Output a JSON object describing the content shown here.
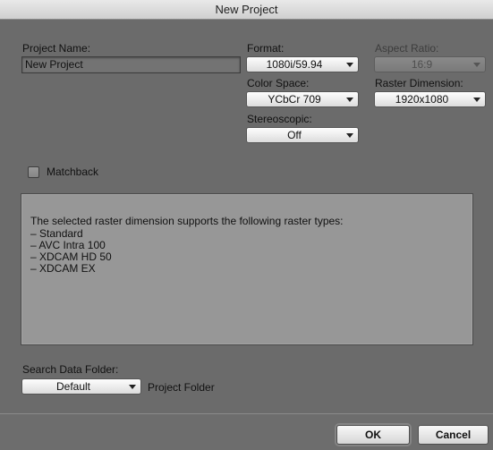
{
  "window": {
    "title": "New Project"
  },
  "project_name": {
    "label": "Project Name:",
    "value": "New Project"
  },
  "format": {
    "label": "Format:",
    "value": "1080i/59.94"
  },
  "aspect_ratio": {
    "label": "Aspect Ratio:",
    "value": "16:9",
    "enabled": false
  },
  "color_space": {
    "label": "Color Space:",
    "value": "YCbCr 709"
  },
  "raster_dimension": {
    "label": "Raster Dimension:",
    "value": "1920x1080"
  },
  "stereoscopic": {
    "label": "Stereoscopic:",
    "value": "Off"
  },
  "matchback": {
    "label": "Matchback",
    "checked": false
  },
  "info": {
    "heading": "The selected raster dimension supports the following raster types:",
    "items": [
      "– Standard",
      "– AVC Intra 100",
      "– XDCAM HD 50",
      "– XDCAM EX"
    ]
  },
  "search_data_folder": {
    "label": "Search Data Folder:",
    "value": "Default",
    "note": "Project Folder"
  },
  "buttons": {
    "ok": "OK",
    "cancel": "Cancel"
  },
  "icons": {
    "popup_arrow": "chevron-down-icon"
  }
}
